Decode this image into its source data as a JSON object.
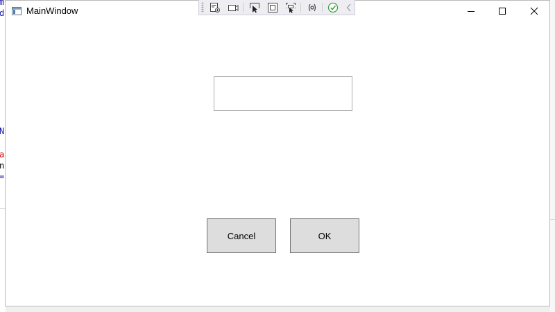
{
  "window": {
    "title": "MainWindow"
  },
  "background_editor": {
    "fragments": [
      "m",
      "d",
      "N",
      "a",
      "n",
      "="
    ]
  },
  "debug_toolbar": {
    "tools": [
      "go-to-live-visual-tree-icon",
      "record-icon",
      "select-element-icon",
      "display-layout-adorners-icon",
      "track-focused-element-icon",
      "binding-failures-icon",
      "hot-reload-ok-icon",
      "collapse-icon"
    ]
  },
  "form": {
    "text_value": "",
    "cancel_label": "Cancel",
    "ok_label": "OK"
  },
  "colors": {
    "button_face": "#dddddd",
    "button_border": "#707070",
    "input_border": "#acacac",
    "hot_reload_ok": "#3ea33e",
    "editor_keyword": "#0000ff",
    "editor_string": "#d40000"
  }
}
